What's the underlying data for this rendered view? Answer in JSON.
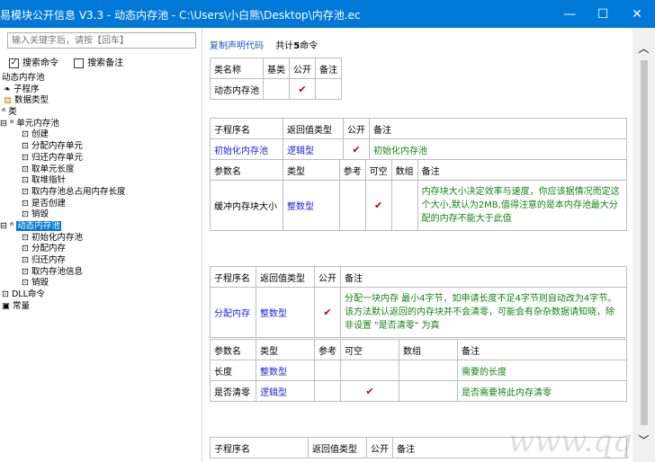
{
  "window": {
    "title": "易模块公开信息 V3.3 - 动态内存池 - C:\\Users\\小白熊\\Desktop\\内存池.ec",
    "minimize": "—",
    "maximize": "☐",
    "close": "✕"
  },
  "search": {
    "placeholder": "输入关键字后，请按【回车】"
  },
  "filters": {
    "search_commands": "搜索命令",
    "search_notes": "搜索备注"
  },
  "tree": [
    "动态内存池",
    "子程序",
    "数据类型",
    "类",
    "单元内存池",
    "创建",
    "分配内存单元",
    "归还内存单元",
    "取单元长度",
    "取堆指针",
    "取内存池总占用内存长度",
    "是否创建",
    "销毁",
    "动态内存池",
    "初始化内存池",
    "分配内存",
    "归还内存",
    "取内存池信息",
    "销毁",
    "DLL命令",
    "常量"
  ],
  "header": {
    "copy_link": "复制声明代码",
    "count_prefix": "共计",
    "count_num": "5",
    "count_suffix": "命令"
  },
  "class_table": {
    "h_name": "类名称",
    "h_base": "基类",
    "h_public": "公开",
    "h_note": "备注",
    "name": "动态内存池",
    "public": "✔"
  },
  "sub1": {
    "h_sub": "子程序名",
    "h_ret": "返回值类型",
    "h_pub": "公开",
    "h_note": "备注",
    "name": "初始化内存池",
    "ret": "逻辑型",
    "pub": "✔",
    "note": "初始化内存池",
    "p_h_name": "参数名",
    "p_h_type": "类型",
    "p_h_ref": "参考",
    "p_h_null": "可空",
    "p_h_arr": "数组",
    "p_h_note": "备注",
    "p1_name": "缓冲内存块大小",
    "p1_type": "整数型",
    "p1_null": "✔",
    "p1_note": "内存块大小决定效率与速度，你应该据情况而定这个大小,默认为2MB,值得注意的是本内存池最大分配的内存不能大于此值"
  },
  "sub2": {
    "h_sub": "子程序名",
    "h_ret": "返回值类型",
    "h_pub": "公开",
    "h_note": "备注",
    "name": "分配内存",
    "ret": "整数型",
    "pub": "✔",
    "note": "分配一块内存 最小4字节，如申请长度不足4字节则自动改为4字节。该方法默认返回的内存块并不会清零，可能会有杂杂数据请知晓，除非设置 \"是否清零\" 为真",
    "p_h_name": "参数名",
    "p_h_type": "类型",
    "p_h_ref": "参考",
    "p_h_null": "可空",
    "p_h_arr": "数组",
    "p_h_note": "备注",
    "p1_name": "长度",
    "p1_type": "整数型",
    "p1_note": "需要的长度",
    "p2_name": "是否清零",
    "p2_type": "逻辑型",
    "p2_null": "✔",
    "p2_note": "是否需要将此内存清零"
  },
  "sub3": {
    "h_sub": "子程序名",
    "h_ret": "返回值类型",
    "h_pub": "公开",
    "h_note": "备注"
  },
  "scroll": {
    "up": "︿",
    "down": "﹀"
  },
  "watermark": "www.qqtn.com"
}
